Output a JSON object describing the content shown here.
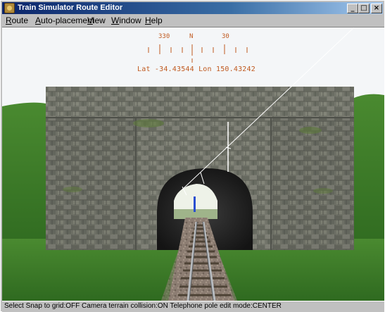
{
  "window": {
    "title": "Train Simulator Route Editor",
    "controls": {
      "minimize": "_",
      "maximize": "□",
      "close": "×"
    }
  },
  "menu": {
    "items": [
      "Route",
      "Auto-placement",
      "View",
      "Window",
      "Help"
    ]
  },
  "hud": {
    "tick_labels": [
      "330",
      "N",
      "30"
    ],
    "coords": "Lat -34.43544 Lon 150.43242"
  },
  "status": {
    "text": "Select   Snap to grid:OFF Camera terrain collision:ON  Telephone pole edit mode:CENTER"
  },
  "colors": {
    "title_gradient_start": "#0a246a",
    "hud_text": "#c05a20",
    "sky": "#f4f6f8",
    "grass": "#3f7a2a"
  },
  "icons": {
    "app": "train-app-icon",
    "minimize": "minimize-icon",
    "maximize": "maximize-icon",
    "close": "close-icon"
  }
}
